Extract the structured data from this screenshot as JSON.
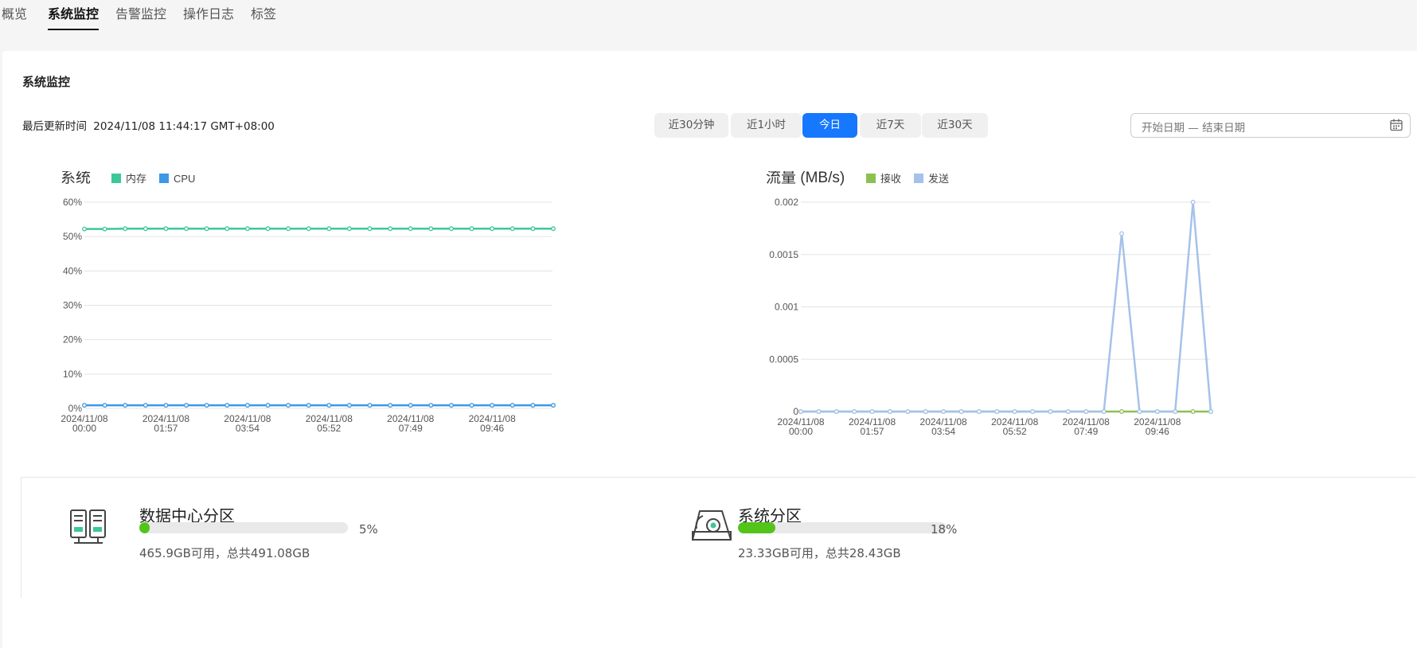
{
  "tabs": [
    {
      "label": "概览"
    },
    {
      "label": "系统监控"
    },
    {
      "label": "告警监控"
    },
    {
      "label": "操作日志"
    },
    {
      "label": "标签"
    }
  ],
  "page": {
    "title": "系统监控",
    "update_label": "最后更新时间",
    "update_time": "2024/11/08 11:44:17 GMT+08:00"
  },
  "time_ranges": [
    {
      "label": "近30分钟",
      "active": false
    },
    {
      "label": "近1小时",
      "active": false
    },
    {
      "label": "今日",
      "active": true
    },
    {
      "label": "近7天",
      "active": false
    },
    {
      "label": "近30天",
      "active": false
    }
  ],
  "date_picker": {
    "start": "开始日期",
    "separator": "—",
    "end": "结束日期"
  },
  "chart_data": [
    {
      "type": "line",
      "title": "系统",
      "x": [
        "2024/11/08 00:00",
        "2024/11/08 01:57",
        "2024/11/08 03:54",
        "2024/11/08 05:52",
        "2024/11/08 07:49",
        "2024/11/08 09:46"
      ],
      "x_tick_labels": [
        [
          "2024/11/08",
          "00:00"
        ],
        [
          "2024/11/08",
          "01:57"
        ],
        [
          "2024/11/08",
          "03:54"
        ],
        [
          "2024/11/08",
          "05:52"
        ],
        [
          "2024/11/08",
          "07:49"
        ],
        [
          "2024/11/08",
          "09:46"
        ]
      ],
      "y_ticks": [
        "0%",
        "10%",
        "20%",
        "30%",
        "40%",
        "50%",
        "60%"
      ],
      "ylim": [
        0,
        60
      ],
      "grid": true,
      "legend_position": "top-left",
      "series": [
        {
          "name": "内存",
          "color": "#3cc79b",
          "values": [
            52.2,
            52.2,
            52.3,
            52.3,
            52.3,
            52.3,
            52.3,
            52.3,
            52.3,
            52.3,
            52.3,
            52.3,
            52.3,
            52.3,
            52.3,
            52.3,
            52.3,
            52.3,
            52.3,
            52.3,
            52.3,
            52.3,
            52.3,
            52.3
          ]
        },
        {
          "name": "CPU",
          "color": "#3d99e6",
          "values": [
            0.9,
            0.9,
            0.9,
            0.9,
            0.9,
            0.9,
            0.9,
            0.9,
            0.9,
            0.9,
            0.9,
            0.9,
            0.9,
            0.9,
            0.9,
            0.9,
            0.9,
            0.9,
            0.9,
            0.9,
            0.9,
            0.9,
            0.9,
            0.9
          ]
        }
      ]
    },
    {
      "type": "line",
      "title": "流量 (MB/s)",
      "x_tick_labels": [
        [
          "2024/11/08",
          "00:00"
        ],
        [
          "2024/11/08",
          "01:57"
        ],
        [
          "2024/11/08",
          "03:54"
        ],
        [
          "2024/11/08",
          "05:52"
        ],
        [
          "2024/11/08",
          "07:49"
        ],
        [
          "2024/11/08",
          "09:46"
        ]
      ],
      "y_ticks": [
        "0",
        "0.0005",
        "0.001",
        "0.0015",
        "0.002"
      ],
      "ylim": [
        0,
        0.002
      ],
      "grid": true,
      "legend_position": "top-left",
      "series": [
        {
          "name": "接收",
          "color": "#8cc152",
          "values": [
            0,
            0,
            0,
            0,
            0,
            0,
            0,
            0,
            0,
            0,
            0,
            0,
            0,
            0,
            0,
            0,
            0,
            0,
            0,
            0,
            0,
            0,
            0,
            0
          ]
        },
        {
          "name": "发送",
          "color": "#a5c2ea",
          "values": [
            0,
            0,
            0,
            0,
            0,
            0,
            0,
            0,
            0,
            0,
            0,
            0,
            0,
            0,
            0,
            0,
            0,
            0,
            0.0017,
            0,
            0,
            0,
            0.002,
            0
          ]
        }
      ]
    }
  ],
  "storage": [
    {
      "title": "数据中心分区",
      "percent": 5,
      "percent_label": "5%",
      "detail": "465.9GB可用，总共491.08GB",
      "icon": "server-rack-icon"
    },
    {
      "title": "系统分区",
      "percent": 18,
      "percent_label": "18%",
      "detail": "23.33GB可用，总共28.43GB",
      "icon": "disk-icon"
    }
  ],
  "colors": {
    "accent": "#1677ff",
    "progress": "#52c41a"
  }
}
